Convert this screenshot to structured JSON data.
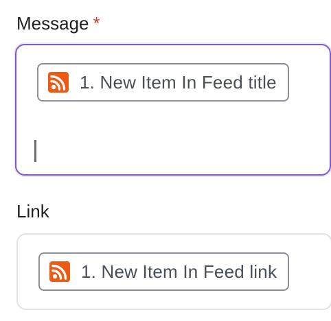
{
  "message_field": {
    "label": "Message",
    "required_marker": "*",
    "token": {
      "icon": "rss-icon",
      "text": "1. New Item In Feed title"
    },
    "focused": true,
    "focus_color": "#7c5ac9"
  },
  "link_field": {
    "label": "Link",
    "token": {
      "icon": "rss-icon",
      "text": "1. New Item In Feed link"
    }
  },
  "colors": {
    "required": "#e0402a",
    "rss_orange": "#ec5a14"
  }
}
